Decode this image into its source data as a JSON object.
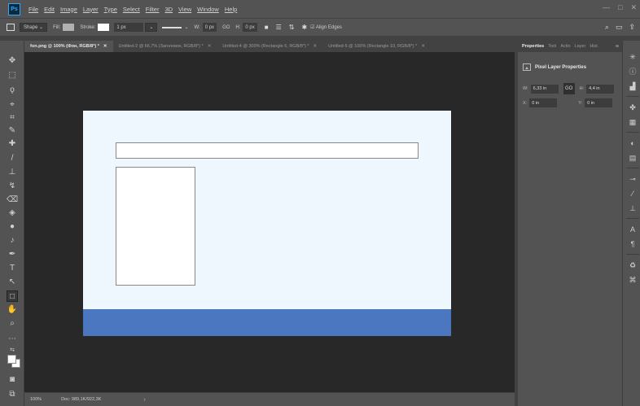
{
  "app": {
    "logo": "Ps"
  },
  "menu": [
    "File",
    "Edit",
    "Image",
    "Layer",
    "Type",
    "Select",
    "Filter",
    "3D",
    "View",
    "Window",
    "Help"
  ],
  "window_controls": {
    "minimize": "—",
    "maximize": "□",
    "close": "✕"
  },
  "options": {
    "mode": "Shape",
    "fill_label": "Fill:",
    "fill_color": "#b0b0b0",
    "stroke_label": "Stroke:",
    "stroke_color": "#ffffff",
    "stroke_width": "1 px",
    "w_label": "W:",
    "w_value": "0 px",
    "link": "GO",
    "h_label": "H:",
    "h_value": "0 px",
    "align_edges": "Align Edges"
  },
  "tabs": [
    {
      "label": "fon.png @ 100% (Фон, RGB/8*) *",
      "active": true
    },
    {
      "label": "Untitled-2 @ 66,7% (Заголовок, RGB/8*) *",
      "active": false
    },
    {
      "label": "Untitled-4 @ 300% (Rectangle 6, RGB/8*) *",
      "active": false
    },
    {
      "label": "Untitled-5 @ 100% (Rectangle 10, RGB/8*) *",
      "active": false
    }
  ],
  "tab_close": "✕",
  "document": {
    "background": "#eef6fe",
    "footer_color": "#4a77c0"
  },
  "status": {
    "zoom": "100%",
    "doc": "Doc: 989,1K/922,3K",
    "arrow": "›"
  },
  "properties": {
    "tabs": [
      "Properties",
      "Tool",
      "Actio",
      "Layer",
      "Hist"
    ],
    "title": "Pixel Layer Properties",
    "w_label": "W:",
    "w_value": "6,33 in",
    "link": "GO",
    "h_label": "H:",
    "h_value": "4,4 in",
    "x_label": "X:",
    "x_value": "0 in",
    "y_label": "Y:",
    "y_value": "0 in"
  }
}
